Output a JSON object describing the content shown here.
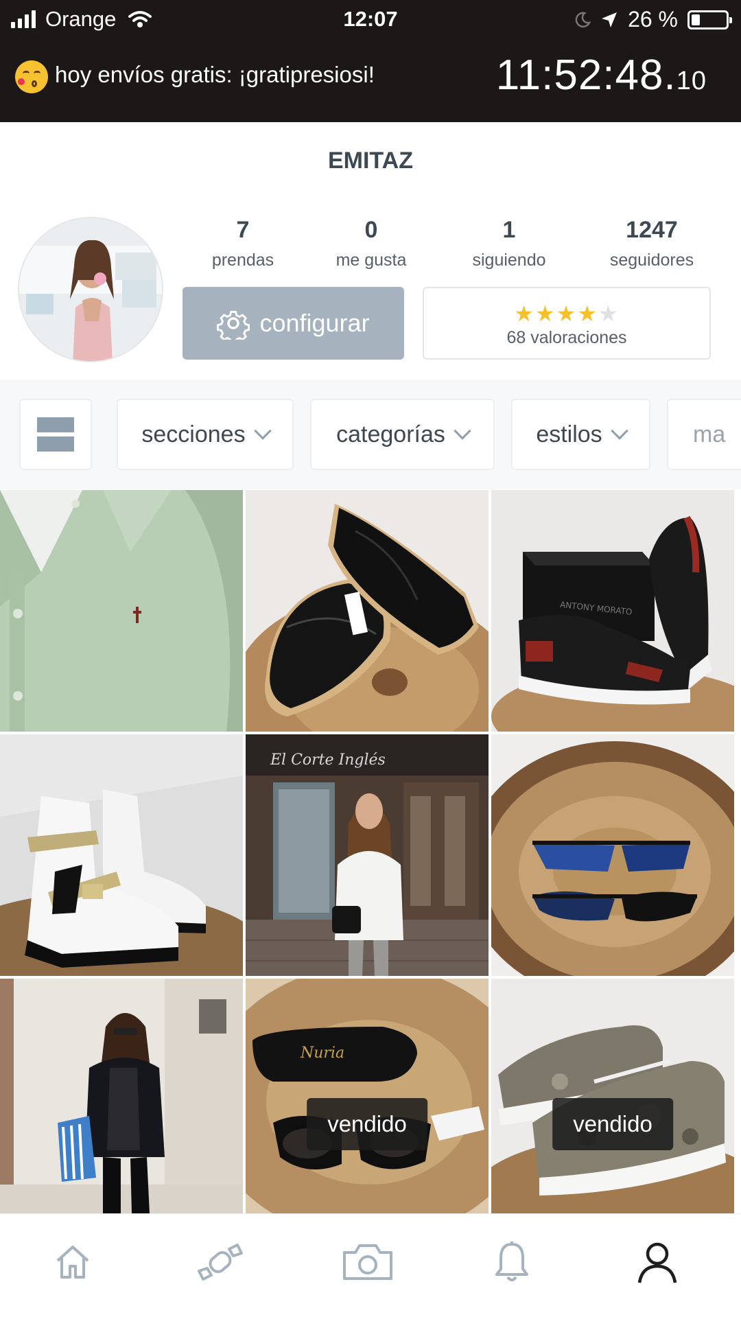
{
  "status_bar": {
    "carrier": "Orange",
    "time": "12:07",
    "battery": "26 %",
    "battery_level": 0.26
  },
  "promo": {
    "text": "hoy envíos gratis: ¡gratipresiosi!",
    "countdown_main": "11:52:48.",
    "countdown_fraction": "10"
  },
  "profile": {
    "username": "EMITAZ",
    "stats": [
      {
        "value": "7",
        "label": "prendas"
      },
      {
        "value": "0",
        "label": "me gusta"
      },
      {
        "value": "1",
        "label": "siguiendo"
      },
      {
        "value": "1247",
        "label": "seguidores"
      }
    ],
    "config_label": "configurar",
    "rating_stars": 4,
    "rating_max": 5,
    "rating_label": "68 valoraciones"
  },
  "filters": {
    "items": [
      "secciones",
      "categorías",
      "estilos",
      "ma"
    ]
  },
  "grid": {
    "items": [
      {
        "name": "green-shirt",
        "sold": ""
      },
      {
        "name": "black-oxford-shoes",
        "sold": ""
      },
      {
        "name": "black-red-sneakers",
        "sold": ""
      },
      {
        "name": "white-buckle-boots",
        "sold": ""
      },
      {
        "name": "woman-white-blouse",
        "sold": ""
      },
      {
        "name": "black-sunglasses",
        "sold": ""
      },
      {
        "name": "woman-black-blazer",
        "sold": ""
      },
      {
        "name": "sunglasses-with-case",
        "sold": "vendido"
      },
      {
        "name": "camo-sneakers",
        "sold": "vendido"
      }
    ]
  },
  "tabbar": {
    "items": [
      "home-icon",
      "candy-icon",
      "camera-icon",
      "bell-icon",
      "profile-icon"
    ],
    "active": "profile-icon"
  },
  "colors": {
    "top_background": "#1c1817",
    "button_gray": "#a6b3bf",
    "star_gold": "#f6c02a",
    "text_dark": "#3d4852"
  }
}
